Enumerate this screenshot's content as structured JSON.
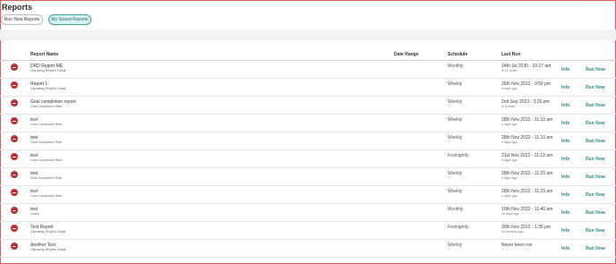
{
  "page": {
    "title": "Reports"
  },
  "tabs": [
    {
      "label": "Run New Reports",
      "active": false
    },
    {
      "label": "My Saved Reports",
      "active": true
    }
  ],
  "table": {
    "columns": {
      "name": "Report Name",
      "date_range": "Date Range",
      "schedule": "Schedule",
      "last_run": "Last Run"
    },
    "info_label": "Info",
    "run_label": "Run Now",
    "rows": [
      {
        "name": "DRD Report ME",
        "type": "Operating Rhythm Detail",
        "schedule": "Monthly",
        "last_run": "14th Jul 2035 - 10:27 am",
        "ago": "in 12 years"
      },
      {
        "name": "Report 1",
        "type": "Operating Rhythm Detail",
        "schedule": "Weekly",
        "last_run": "26th Nov 2022 - 9:50 pm",
        "ago": "4 days ago"
      },
      {
        "name": "Goal completion report",
        "type": "Goal Completion Rate",
        "schedule": "Weekly",
        "last_run": "2nd Sep 2023 - 3:25 pm",
        "ago": "in 9 years"
      },
      {
        "name": "test",
        "type": "Goal Completion Rate",
        "schedule": "Weekly",
        "last_run": "28th Nov 2022 - 11:10 am",
        "ago": "2 days ago"
      },
      {
        "name": "test",
        "type": "Goal Completion Rate",
        "schedule": "Weekly",
        "last_run": "28th Nov 2022 - 11:10 am",
        "ago": "2 days ago"
      },
      {
        "name": "test",
        "type": "Goal Completion Rate",
        "schedule": "Fortnightly",
        "last_run": "21st Nov 2022 - 11:13 am",
        "ago": "9 days ago"
      },
      {
        "name": "test",
        "type": "Goal Completion Rate",
        "schedule": "Weekly",
        "last_run": "28th Nov 2022 - 11:20 am",
        "ago": "2 days ago"
      },
      {
        "name": "test",
        "type": "Goal Completion Rate",
        "schedule": "Weekly",
        "last_run": "28th Nov 2022 - 11:25 am",
        "ago": "2 days ago"
      },
      {
        "name": "test",
        "type": "Leave",
        "schedule": "Monthly",
        "last_run": "10th Nov 2022 - 11:40 am",
        "ago": "20 days ago"
      },
      {
        "name": "Test Report",
        "type": "Operating Rhythm Detail",
        "schedule": "Fortnightly",
        "last_run": "30th Nov 2022 - 1:35 pm",
        "ago": "25 minutes ago"
      },
      {
        "name": "Another Test",
        "type": "Operating Rhythm Detail",
        "schedule": "Weekly",
        "last_run": "Never been run",
        "ago": ""
      }
    ]
  },
  "colors": {
    "accent": "#2a8c86",
    "delete": "#c22b2b",
    "frame": "#e05a5a"
  },
  "icons": {
    "delete": "minus-circle-icon"
  }
}
